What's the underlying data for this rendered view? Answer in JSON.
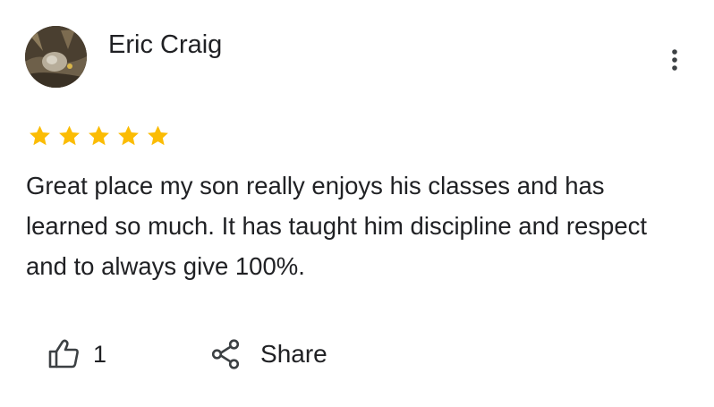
{
  "review": {
    "reviewer_name": "Eric Craig",
    "rating": 5,
    "rating_max": 5,
    "text": "Great place my son really enjoys his classes and has learned so much. It has taught him discipline and respect and to always give 100%.",
    "like_count": "1",
    "share_label": "Share"
  },
  "icons": {
    "more": "more-vert-icon",
    "like": "thumb-up-icon",
    "share": "share-icon",
    "star": "star-icon"
  },
  "colors": {
    "star": "#fbbc04",
    "text": "#202124",
    "icon": "#3c4043"
  }
}
